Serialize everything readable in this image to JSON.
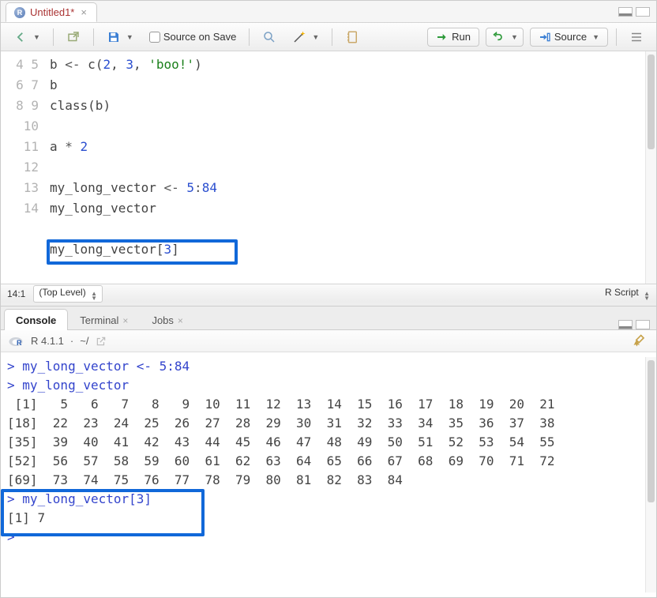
{
  "source": {
    "tab_title": "Untitled1*",
    "toolbar": {
      "source_on_save": "Source on Save",
      "run": "Run",
      "source": "Source"
    },
    "lines": {
      "l4": [
        "b ",
        "<-",
        " ",
        "c",
        "(",
        "2",
        ", ",
        "3",
        ", ",
        "'boo!'",
        ")"
      ],
      "l5": "b",
      "l6_a": "class",
      "l6_b": "(b)",
      "l7": "",
      "l8_a": "a ",
      "l8_b": "*",
      "l8_c": " ",
      "l8_d": "2",
      "l9": "",
      "l10_a": "my_long_vector ",
      "l10_b": "<-",
      "l10_c": " ",
      "l10_d": "5",
      "l10_e": ":",
      "l10_f": "84",
      "l11": "my_long_vector",
      "l12": "",
      "l13_a": "my_long_vector",
      "l13_b": "[",
      "l13_c": "3",
      "l13_d": "]",
      "l14": ""
    },
    "gutters": [
      "4",
      "5",
      "6",
      "7",
      "8",
      "9",
      "10",
      "11",
      "12",
      "13",
      "14"
    ],
    "status": {
      "pos": "14:1",
      "scope": "(Top Level)",
      "type": "R Script"
    }
  },
  "console": {
    "tabs": {
      "console": "Console",
      "terminal": "Terminal",
      "jobs": "Jobs"
    },
    "head": {
      "version": "R 4.1.1",
      "path": "~/"
    },
    "lines": {
      "p1": "> my_long_vector <- 5:84",
      "p2": "> my_long_vector",
      "o1": " [1]   5   6   7   8   9  10  11  12  13  14  15  16  17  18  19  20  21",
      "o2": "[18]  22  23  24  25  26  27  28  29  30  31  32  33  34  35  36  37  38",
      "o3": "[35]  39  40  41  42  43  44  45  46  47  48  49  50  51  52  53  54  55",
      "o4": "[52]  56  57  58  59  60  61  62  63  64  65  66  67  68  69  70  71  72",
      "o5": "[69]  73  74  75  76  77  78  79  80  81  82  83  84",
      "p3": "> my_long_vector[3]",
      "o6": "[1] 7",
      "p4": "> "
    }
  }
}
